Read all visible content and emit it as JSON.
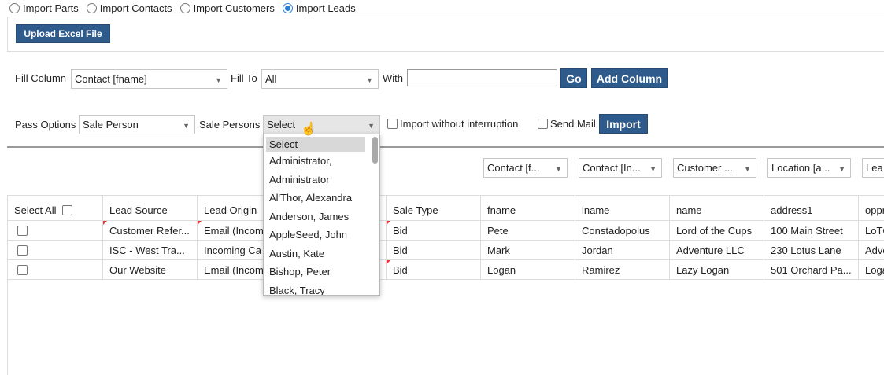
{
  "import_types": [
    {
      "label": "Import Parts",
      "checked": false
    },
    {
      "label": "Import Contacts",
      "checked": false
    },
    {
      "label": "Import Customers",
      "checked": false
    },
    {
      "label": "Import Leads",
      "checked": true
    }
  ],
  "upload_label": "Upload Excel File",
  "fill": {
    "column_label": "Fill Column",
    "column_value": "Contact [fname]",
    "to_label": "Fill To",
    "to_value": "All",
    "with_label": "With",
    "with_value": "",
    "go_label": "Go",
    "add_column_label": "Add Column"
  },
  "pass": {
    "options_label": "Pass Options",
    "options_value": "Sale Person",
    "persons_label": "Sale Persons",
    "persons_value": "Select",
    "without_interruption_label": "Import without interruption",
    "send_mail_label": "Send Mail",
    "import_label": "Import"
  },
  "dropdown_options": [
    "Select",
    "Administrator,",
    "Administrator",
    "Al'Thor, Alexandra",
    "Anderson, James",
    "AppleSeed, John",
    "Austin, Kate",
    "Bishop, Peter",
    "Black, Tracy"
  ],
  "mapping_selects": [
    "Contact [f...",
    "Contact [In...",
    "Customer ...",
    "Location [a...",
    "Lea"
  ],
  "table": {
    "select_all_label": "Select All",
    "headers": [
      "Lead Source",
      "Lead Origin",
      "Sale Type",
      "fname",
      "lname",
      "name",
      "address1",
      "oppr"
    ],
    "rows": [
      [
        "Customer Refer...",
        "Email (Incom",
        "Bid",
        "Pete",
        "Constadopolus",
        "Lord of the Cups",
        "100 Main Street",
        "LoTC"
      ],
      [
        "ISC - West Tra...",
        "Incoming Ca",
        "Bid",
        "Mark",
        "Jordan",
        "Adventure LLC",
        "230 Lotus Lane",
        "Adve"
      ],
      [
        "Our Website",
        "Email (Incom",
        "Bid",
        "Logan",
        "Ramirez",
        "Lazy Logan",
        "501 Orchard Pa...",
        "Loga"
      ]
    ]
  },
  "colors": {
    "primary_button": "#2f5a8c",
    "radio_checked": "#2a7fd4",
    "flag": "#ee3333"
  }
}
